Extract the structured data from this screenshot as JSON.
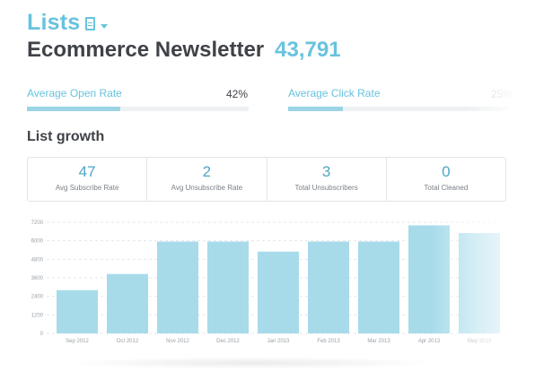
{
  "header": {
    "lists_title": "Lists",
    "list_name": "Ecommerce Newsletter",
    "list_count": "43,791",
    "icons": [
      "document-icon",
      "chevron-down-icon"
    ]
  },
  "rates": {
    "open": {
      "label": "Average Open Rate",
      "value": "42%",
      "fraction": 0.42
    },
    "click": {
      "label": "Average Click Rate",
      "value": "25%",
      "fraction": 0.25
    }
  },
  "growth": {
    "title": "List growth",
    "stats": [
      {
        "value": "47",
        "label": "Avg Subscribe Rate"
      },
      {
        "value": "2",
        "label": "Avg Unsubscribe Rate"
      },
      {
        "value": "3",
        "label": "Total Unsubscribers"
      },
      {
        "value": "0",
        "label": "Total Cleaned"
      }
    ]
  },
  "colors": {
    "accent": "#67c3de",
    "bar": "#a7dbea",
    "heading": "#3f4247"
  },
  "chart_data": {
    "type": "bar",
    "categories": [
      "Sep 2012",
      "Oct 2012",
      "Nov 2012",
      "Dec 2012",
      "Jan 2013",
      "Feb 2013",
      "Mar 2013",
      "Apr 2013",
      "May 2013"
    ],
    "values": [
      2800,
      3850,
      5950,
      5950,
      5300,
      5950,
      5950,
      7000,
      6500
    ],
    "yticks": [
      "0",
      "1200",
      "2400",
      "3600",
      "4800",
      "6000",
      "7200"
    ],
    "ylim": [
      0,
      7200
    ],
    "title": "",
    "xlabel": "",
    "ylabel": "",
    "grid": true
  }
}
